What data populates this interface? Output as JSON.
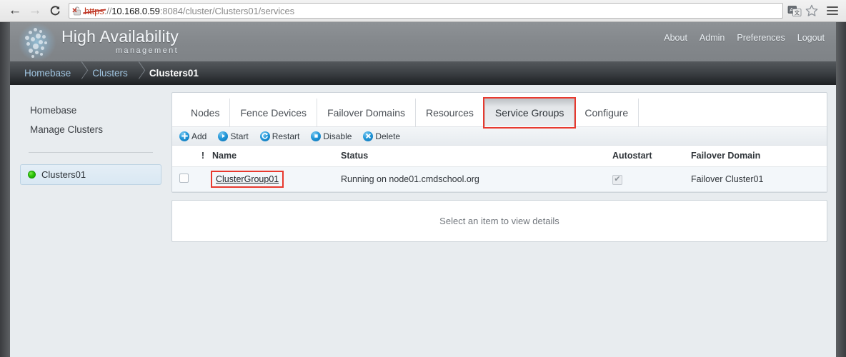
{
  "browser": {
    "back_icon": "back-arrow-icon",
    "forward_icon": "forward-arrow-icon",
    "reload_icon": "reload-icon",
    "security_icon": "broken-lock-icon",
    "url_scheme": "https",
    "url_separator": "://",
    "url_host": "10.168.0.59",
    "url_rest": ":8084/cluster/Clusters01/services",
    "url_full": "https://10.168.0.59:8084/cluster/Clusters01/services",
    "translate_icon": "translate-icon",
    "bookmark_icon": "star-icon",
    "menu_icon": "hamburger-menu-icon"
  },
  "header": {
    "brand_title": "High Availability",
    "brand_subtitle": "management",
    "logo_icon": "dot-cluster-logo-icon",
    "nav": [
      {
        "label": "About"
      },
      {
        "label": "Admin"
      },
      {
        "label": "Preferences"
      },
      {
        "label": "Logout"
      }
    ]
  },
  "breadcrumb": [
    {
      "label": "Homebase",
      "current": false
    },
    {
      "label": "Clusters",
      "current": false
    },
    {
      "label": "Clusters01",
      "current": true
    }
  ],
  "sidebar": {
    "links": [
      {
        "label": "Homebase"
      },
      {
        "label": "Manage Clusters"
      }
    ],
    "cluster_item": {
      "label": "Clusters01",
      "status_icon": "green-status-dot-icon",
      "status_color": "#2fc508"
    }
  },
  "tabs": [
    {
      "label": "Nodes",
      "active": false
    },
    {
      "label": "Fence Devices",
      "active": false
    },
    {
      "label": "Failover Domains",
      "active": false
    },
    {
      "label": "Resources",
      "active": false
    },
    {
      "label": "Service Groups",
      "active": true
    },
    {
      "label": "Configure",
      "active": false
    }
  ],
  "toolbar": {
    "add_label": "Add",
    "start_label": "Start",
    "restart_label": "Restart",
    "disable_label": "Disable",
    "delete_label": "Delete",
    "add_icon": "plus-circle-icon",
    "start_icon": "play-circle-icon",
    "restart_icon": "refresh-circle-icon",
    "disable_icon": "stop-circle-icon",
    "delete_icon": "x-circle-icon",
    "icon_color": "#2196d8"
  },
  "table": {
    "columns": {
      "select": "",
      "alert": "!",
      "name": "Name",
      "status": "Status",
      "autostart": "Autostart",
      "failover_domain": "Failover Domain"
    },
    "rows": [
      {
        "selected": false,
        "alert": "",
        "name": "ClusterGroup01",
        "status": "Running on node01.cmdschool.org",
        "autostart": true,
        "autostart_glyph": "✔",
        "failover_domain": "Failover Cluster01"
      }
    ]
  },
  "details": {
    "empty_message": "Select an item to view details"
  },
  "annotations": {
    "color": "#e8392e",
    "targets": [
      "Service Groups tab",
      "ClusterGroup01 link",
      "https scheme strikethrough"
    ]
  }
}
